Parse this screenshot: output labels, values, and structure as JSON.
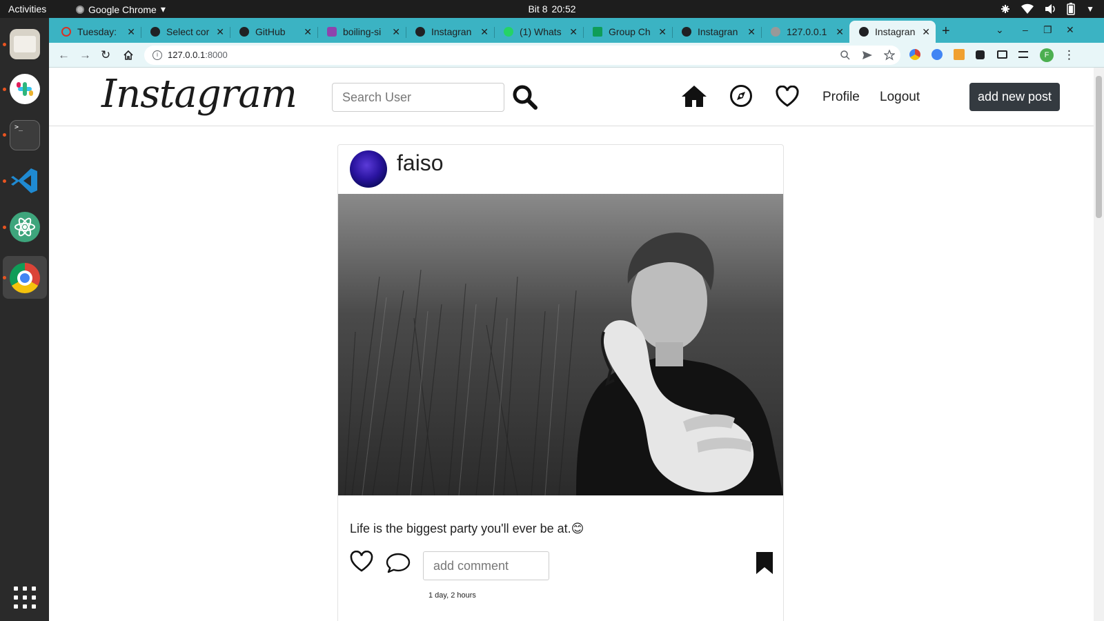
{
  "os": {
    "activities": "Activities",
    "app_name": "Google Chrome",
    "clock_day": "Bit 8",
    "clock_time": "20:52"
  },
  "browser": {
    "tabs": [
      {
        "label": "Tuesday:",
        "favicon_color": "#d93025"
      },
      {
        "label": "Select cor",
        "favicon_color": "#202124"
      },
      {
        "label": "GitHub",
        "favicon_color": "#202124"
      },
      {
        "label": "boiling-si",
        "favicon_color": "#8e44ad"
      },
      {
        "label": "Instagran",
        "favicon_color": "#202124"
      },
      {
        "label": "(1) Whats",
        "favicon_color": "#25d366"
      },
      {
        "label": "Group Ch",
        "favicon_color": "#0f9d58"
      },
      {
        "label": "Instagran",
        "favicon_color": "#202124"
      },
      {
        "label": "127.0.0.1",
        "favicon_color": "#999999"
      },
      {
        "label": "Instagran",
        "favicon_color": "#202124"
      }
    ],
    "new_tab_symbol": "+",
    "url_host": "127.0.0.1",
    "url_port": ":8000",
    "accent": "#3bb3c3",
    "profile_letter": "F"
  },
  "site": {
    "logo": "Instagram",
    "search_placeholder": "Search User",
    "profile_link": "Profile",
    "logout_link": "Logout",
    "add_post_label": "add new post"
  },
  "post": {
    "username": "faiso",
    "caption": "Life is the biggest party you'll ever be at.😊",
    "comment_placeholder": "add comment",
    "timestamp": "1 day, 2 hours"
  }
}
